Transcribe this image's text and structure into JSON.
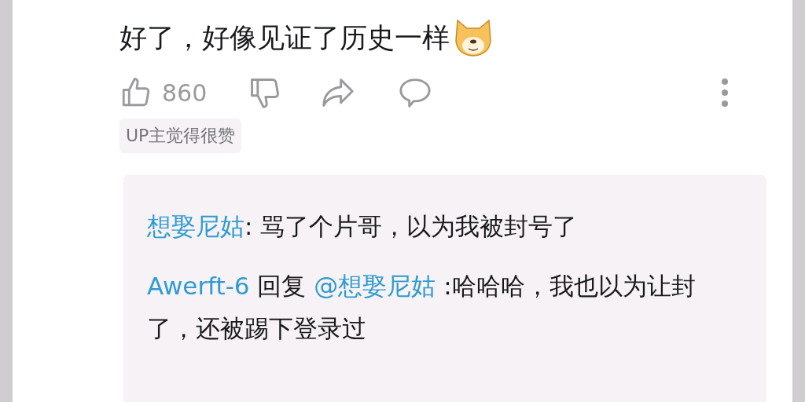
{
  "comment": {
    "text": "好了，好像见证了历史一样",
    "likes": "860",
    "tag": "UP主觉得很赞"
  },
  "replies": [
    {
      "kind": "plain",
      "author": "想娶尼姑",
      "text": ": 骂了个片哥，以为我被封号了"
    },
    {
      "kind": "reply",
      "author": "Awerft-6",
      "reply_label": "回复",
      "mention": "@想娶尼姑",
      "text": " :哈哈哈，我也以为让封了，还被踢下登录过"
    }
  ]
}
